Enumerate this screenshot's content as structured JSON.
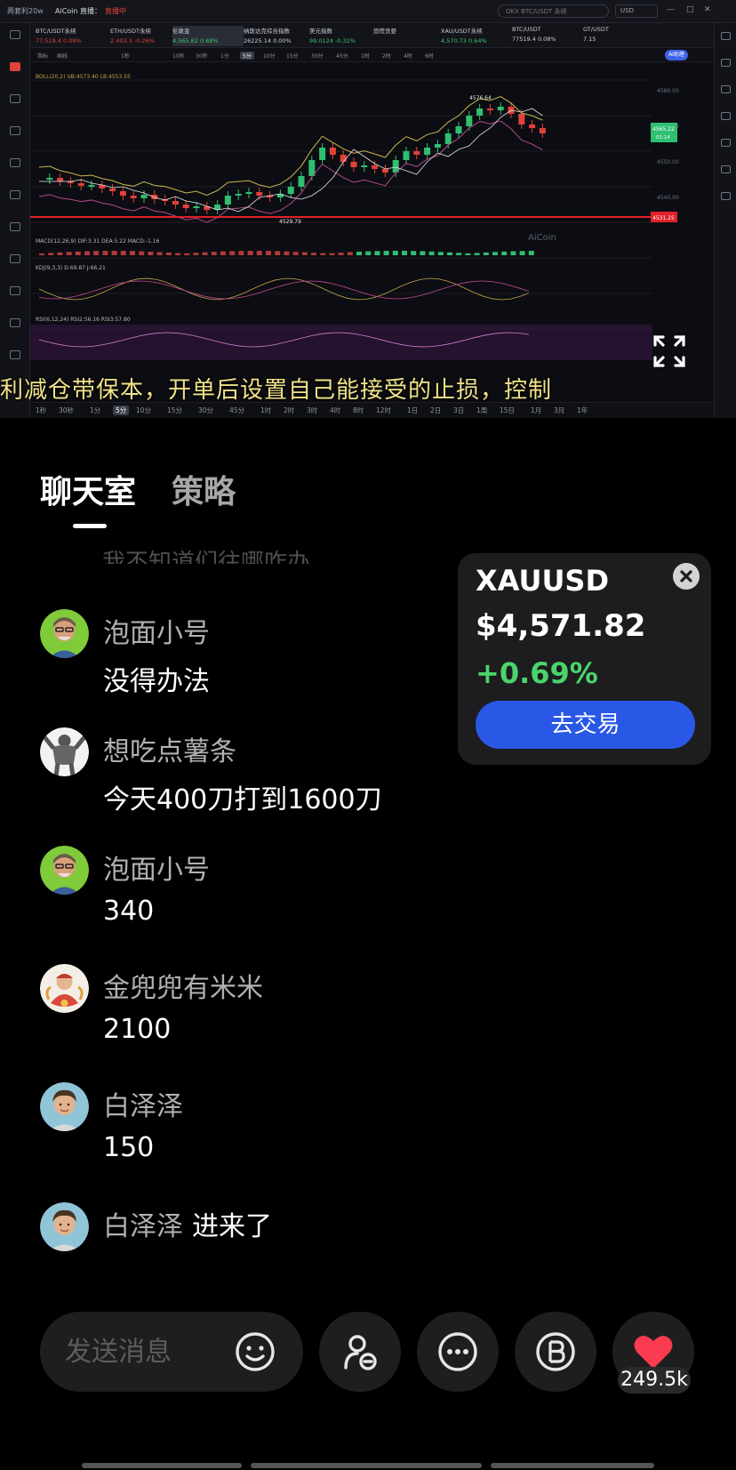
{
  "video": {
    "os_bar": {
      "app_title": "两套利20w",
      "channel": "AiCoin 直播：",
      "live_status": "直播中",
      "search_placeholder": "OKX BTC/USDT 永续",
      "currency": "USD"
    },
    "tickers": [
      {
        "symbol": "BTC/USDT永续",
        "price": "77,519.4 0.08%",
        "color": "#e0423a"
      },
      {
        "symbol": "ETH/USDT永续",
        "price": "2,403.3 -0.26%",
        "color": "#e0423a"
      },
      {
        "symbol": "伦敦金",
        "price": "4,565.82 0.68%",
        "color": "#3bc46d"
      },
      {
        "symbol": "纳斯达克综合指数",
        "price": "26225.14 0.00%",
        "color": "#c9ccd4"
      },
      {
        "symbol": "美元指数",
        "price": "99.0124 -0.32%",
        "color": "#3bc46d"
      },
      {
        "symbol": "恐慌贪婪",
        "price": "",
        "color": "#c9ccd4"
      },
      {
        "symbol": "XAU/USDT永续",
        "price": "4,570.73 0.64%",
        "color": "#3bc46d"
      },
      {
        "symbol": "BTC/USDT",
        "price": "77519.4 0.08%",
        "color": "#c9ccd4"
      },
      {
        "symbol": "GT/USDT",
        "price": "7.15",
        "color": "#c9ccd4"
      }
    ],
    "toolbar": {
      "items": [
        "指标",
        "画线",
        "1秒",
        "10秒",
        "30秒",
        "1分",
        "5分",
        "10分",
        "15分",
        "30分",
        "45分",
        "1时",
        "2时",
        "4时",
        "6时"
      ],
      "selected": "5分",
      "ai_label": "AI助理"
    },
    "chart": {
      "legend_main": "BOLL(20,2) UB:4573.40 LB:4553.55",
      "legend_macd": "MACD(12,26,9) DIF:3.31 DEA:5.22 MACD:-1.16",
      "legend_kdj": "KDJ(9,3,3) D:69.87 J:66.21",
      "legend_rsi": "RSI(6,12,24) RSI2:56.16 RSI3:57.80",
      "high_label": "4576.64",
      "low_label": "4529.79",
      "price_tag": "4565.22",
      "price_tag_sub": "01:14",
      "red_line_label": "4531.25",
      "price_axis": [
        "4580.00",
        "4570.00",
        "4550.00",
        "4540.00"
      ],
      "watermark": "AiCoin"
    },
    "subtitle": "利减仓带保本，开单后设置自己能接受的止损，控制",
    "timeframes": [
      "1秒",
      "30秒",
      "1分",
      "5分",
      "10分",
      "15分",
      "30分",
      "45分",
      "1时",
      "2时",
      "3时",
      "4时",
      "8时",
      "12时",
      "1日",
      "2日",
      "3日",
      "1周",
      "15日",
      "1月",
      "3月",
      "1年"
    ],
    "timeframe_selected": "5分"
  },
  "tabs": {
    "chat": "聊天室",
    "strategy": "策略"
  },
  "faded_message": "我不知道们往哪咋办",
  "messages": [
    {
      "user": "泡面小号",
      "text": "没得办法"
    },
    {
      "user": "想吃点薯条",
      "text": "今天400刀打到1600刀"
    },
    {
      "user": "泡面小号",
      "text": "340"
    },
    {
      "user": "金兜兜有米米",
      "text": "2100"
    },
    {
      "user": "白泽泽",
      "text": "150"
    }
  ],
  "join_notice": {
    "user": "白泽泽",
    "text": "进来了"
  },
  "ticker_card": {
    "symbol": "XAUUSD",
    "price": "$4,571.82",
    "change": "+0.69%",
    "trade_button": "去交易"
  },
  "composer": {
    "placeholder": "发送消息"
  },
  "likes": "249.5k"
}
